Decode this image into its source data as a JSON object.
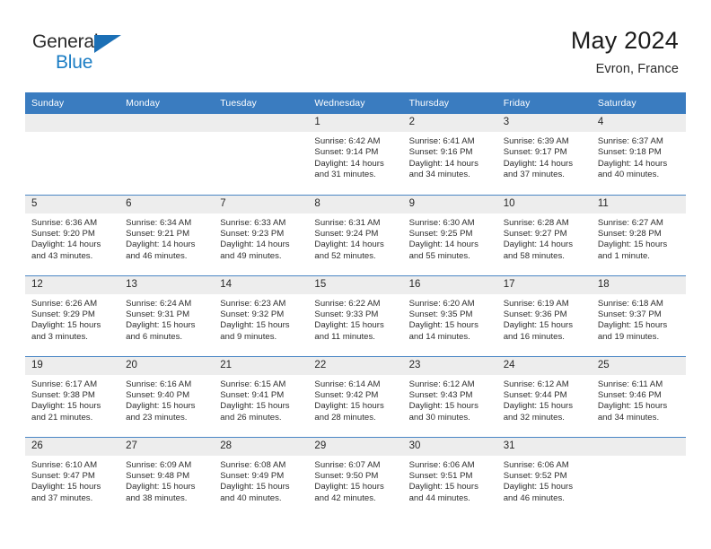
{
  "brand": {
    "name_part1": "General",
    "name_part2": "Blue",
    "triangle_color": "#1b6fb5",
    "blue_color": "#1b7dc4"
  },
  "header": {
    "title": "May 2024",
    "location": "Evron, France"
  },
  "theme": {
    "header_bg": "#3a7cc0",
    "daynum_bg": "#ededed",
    "text_color": "#2e2e2e"
  },
  "weekdays": [
    "Sunday",
    "Monday",
    "Tuesday",
    "Wednesday",
    "Thursday",
    "Friday",
    "Saturday"
  ],
  "labels": {
    "sunrise": "Sunrise:",
    "sunset": "Sunset:",
    "daylight": "Daylight:"
  },
  "weeks": [
    [
      {
        "day": "",
        "blank": true,
        "sunrise": "",
        "sunset": "",
        "daylight1": "",
        "daylight2": ""
      },
      {
        "day": "",
        "blank": true,
        "sunrise": "",
        "sunset": "",
        "daylight1": "",
        "daylight2": ""
      },
      {
        "day": "",
        "blank": true,
        "sunrise": "",
        "sunset": "",
        "daylight1": "",
        "daylight2": ""
      },
      {
        "day": "1",
        "blank": false,
        "sunrise": "Sunrise: 6:42 AM",
        "sunset": "Sunset: 9:14 PM",
        "daylight1": "Daylight: 14 hours",
        "daylight2": "and 31 minutes."
      },
      {
        "day": "2",
        "blank": false,
        "sunrise": "Sunrise: 6:41 AM",
        "sunset": "Sunset: 9:16 PM",
        "daylight1": "Daylight: 14 hours",
        "daylight2": "and 34 minutes."
      },
      {
        "day": "3",
        "blank": false,
        "sunrise": "Sunrise: 6:39 AM",
        "sunset": "Sunset: 9:17 PM",
        "daylight1": "Daylight: 14 hours",
        "daylight2": "and 37 minutes."
      },
      {
        "day": "4",
        "blank": false,
        "sunrise": "Sunrise: 6:37 AM",
        "sunset": "Sunset: 9:18 PM",
        "daylight1": "Daylight: 14 hours",
        "daylight2": "and 40 minutes."
      }
    ],
    [
      {
        "day": "5",
        "blank": false,
        "sunrise": "Sunrise: 6:36 AM",
        "sunset": "Sunset: 9:20 PM",
        "daylight1": "Daylight: 14 hours",
        "daylight2": "and 43 minutes."
      },
      {
        "day": "6",
        "blank": false,
        "sunrise": "Sunrise: 6:34 AM",
        "sunset": "Sunset: 9:21 PM",
        "daylight1": "Daylight: 14 hours",
        "daylight2": "and 46 minutes."
      },
      {
        "day": "7",
        "blank": false,
        "sunrise": "Sunrise: 6:33 AM",
        "sunset": "Sunset: 9:23 PM",
        "daylight1": "Daylight: 14 hours",
        "daylight2": "and 49 minutes."
      },
      {
        "day": "8",
        "blank": false,
        "sunrise": "Sunrise: 6:31 AM",
        "sunset": "Sunset: 9:24 PM",
        "daylight1": "Daylight: 14 hours",
        "daylight2": "and 52 minutes."
      },
      {
        "day": "9",
        "blank": false,
        "sunrise": "Sunrise: 6:30 AM",
        "sunset": "Sunset: 9:25 PM",
        "daylight1": "Daylight: 14 hours",
        "daylight2": "and 55 minutes."
      },
      {
        "day": "10",
        "blank": false,
        "sunrise": "Sunrise: 6:28 AM",
        "sunset": "Sunset: 9:27 PM",
        "daylight1": "Daylight: 14 hours",
        "daylight2": "and 58 minutes."
      },
      {
        "day": "11",
        "blank": false,
        "sunrise": "Sunrise: 6:27 AM",
        "sunset": "Sunset: 9:28 PM",
        "daylight1": "Daylight: 15 hours",
        "daylight2": "and 1 minute."
      }
    ],
    [
      {
        "day": "12",
        "blank": false,
        "sunrise": "Sunrise: 6:26 AM",
        "sunset": "Sunset: 9:29 PM",
        "daylight1": "Daylight: 15 hours",
        "daylight2": "and 3 minutes."
      },
      {
        "day": "13",
        "blank": false,
        "sunrise": "Sunrise: 6:24 AM",
        "sunset": "Sunset: 9:31 PM",
        "daylight1": "Daylight: 15 hours",
        "daylight2": "and 6 minutes."
      },
      {
        "day": "14",
        "blank": false,
        "sunrise": "Sunrise: 6:23 AM",
        "sunset": "Sunset: 9:32 PM",
        "daylight1": "Daylight: 15 hours",
        "daylight2": "and 9 minutes."
      },
      {
        "day": "15",
        "blank": false,
        "sunrise": "Sunrise: 6:22 AM",
        "sunset": "Sunset: 9:33 PM",
        "daylight1": "Daylight: 15 hours",
        "daylight2": "and 11 minutes."
      },
      {
        "day": "16",
        "blank": false,
        "sunrise": "Sunrise: 6:20 AM",
        "sunset": "Sunset: 9:35 PM",
        "daylight1": "Daylight: 15 hours",
        "daylight2": "and 14 minutes."
      },
      {
        "day": "17",
        "blank": false,
        "sunrise": "Sunrise: 6:19 AM",
        "sunset": "Sunset: 9:36 PM",
        "daylight1": "Daylight: 15 hours",
        "daylight2": "and 16 minutes."
      },
      {
        "day": "18",
        "blank": false,
        "sunrise": "Sunrise: 6:18 AM",
        "sunset": "Sunset: 9:37 PM",
        "daylight1": "Daylight: 15 hours",
        "daylight2": "and 19 minutes."
      }
    ],
    [
      {
        "day": "19",
        "blank": false,
        "sunrise": "Sunrise: 6:17 AM",
        "sunset": "Sunset: 9:38 PM",
        "daylight1": "Daylight: 15 hours",
        "daylight2": "and 21 minutes."
      },
      {
        "day": "20",
        "blank": false,
        "sunrise": "Sunrise: 6:16 AM",
        "sunset": "Sunset: 9:40 PM",
        "daylight1": "Daylight: 15 hours",
        "daylight2": "and 23 minutes."
      },
      {
        "day": "21",
        "blank": false,
        "sunrise": "Sunrise: 6:15 AM",
        "sunset": "Sunset: 9:41 PM",
        "daylight1": "Daylight: 15 hours",
        "daylight2": "and 26 minutes."
      },
      {
        "day": "22",
        "blank": false,
        "sunrise": "Sunrise: 6:14 AM",
        "sunset": "Sunset: 9:42 PM",
        "daylight1": "Daylight: 15 hours",
        "daylight2": "and 28 minutes."
      },
      {
        "day": "23",
        "blank": false,
        "sunrise": "Sunrise: 6:12 AM",
        "sunset": "Sunset: 9:43 PM",
        "daylight1": "Daylight: 15 hours",
        "daylight2": "and 30 minutes."
      },
      {
        "day": "24",
        "blank": false,
        "sunrise": "Sunrise: 6:12 AM",
        "sunset": "Sunset: 9:44 PM",
        "daylight1": "Daylight: 15 hours",
        "daylight2": "and 32 minutes."
      },
      {
        "day": "25",
        "blank": false,
        "sunrise": "Sunrise: 6:11 AM",
        "sunset": "Sunset: 9:46 PM",
        "daylight1": "Daylight: 15 hours",
        "daylight2": "and 34 minutes."
      }
    ],
    [
      {
        "day": "26",
        "blank": false,
        "sunrise": "Sunrise: 6:10 AM",
        "sunset": "Sunset: 9:47 PM",
        "daylight1": "Daylight: 15 hours",
        "daylight2": "and 37 minutes."
      },
      {
        "day": "27",
        "blank": false,
        "sunrise": "Sunrise: 6:09 AM",
        "sunset": "Sunset: 9:48 PM",
        "daylight1": "Daylight: 15 hours",
        "daylight2": "and 38 minutes."
      },
      {
        "day": "28",
        "blank": false,
        "sunrise": "Sunrise: 6:08 AM",
        "sunset": "Sunset: 9:49 PM",
        "daylight1": "Daylight: 15 hours",
        "daylight2": "and 40 minutes."
      },
      {
        "day": "29",
        "blank": false,
        "sunrise": "Sunrise: 6:07 AM",
        "sunset": "Sunset: 9:50 PM",
        "daylight1": "Daylight: 15 hours",
        "daylight2": "and 42 minutes."
      },
      {
        "day": "30",
        "blank": false,
        "sunrise": "Sunrise: 6:06 AM",
        "sunset": "Sunset: 9:51 PM",
        "daylight1": "Daylight: 15 hours",
        "daylight2": "and 44 minutes."
      },
      {
        "day": "31",
        "blank": false,
        "sunrise": "Sunrise: 6:06 AM",
        "sunset": "Sunset: 9:52 PM",
        "daylight1": "Daylight: 15 hours",
        "daylight2": "and 46 minutes."
      },
      {
        "day": "",
        "blank": true,
        "sunrise": "",
        "sunset": "",
        "daylight1": "",
        "daylight2": ""
      }
    ]
  ]
}
